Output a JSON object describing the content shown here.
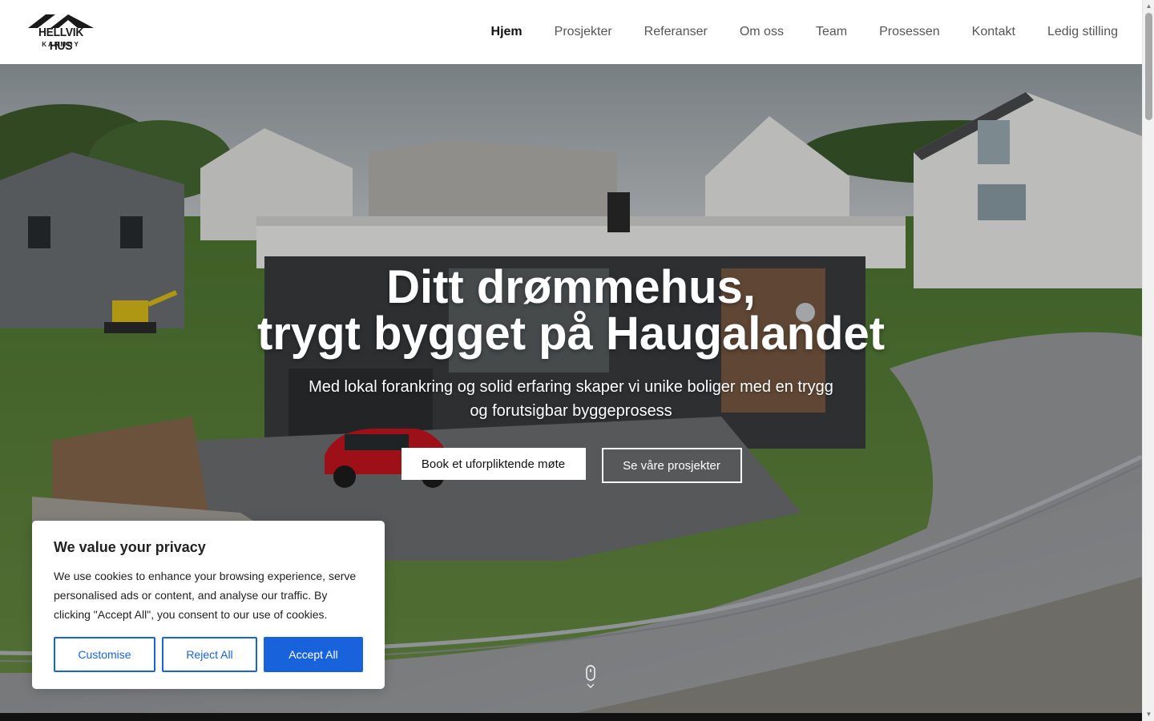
{
  "brand": {
    "name": "HELLVIK HUS",
    "sub": "KARMØY"
  },
  "nav": {
    "items": [
      {
        "label": "Hjem",
        "active": true
      },
      {
        "label": "Prosjekter",
        "active": false
      },
      {
        "label": "Referanser",
        "active": false
      },
      {
        "label": "Om oss",
        "active": false
      },
      {
        "label": "Team",
        "active": false
      },
      {
        "label": "Prosessen",
        "active": false
      },
      {
        "label": "Kontakt",
        "active": false
      },
      {
        "label": "Ledig stilling",
        "active": false
      }
    ]
  },
  "hero": {
    "title_line1": "Ditt drømmehus,",
    "title_line2": "trygt bygget på Haugalandet",
    "subtitle": "Med lokal forankring og solid erfaring skaper vi unike boliger med en trygg og forutsigbar byggeprosess",
    "primary_button": "Book et uforpliktende møte",
    "secondary_button": "Se våre prosjekter",
    "image_icon": "house-photo"
  },
  "cookie": {
    "title": "We value your privacy",
    "text": "We use cookies to enhance your browsing experience, serve personalised ads or content, and analyse our traffic. By clicking \"Accept All\", you consent to our use of cookies.",
    "customise": "Customise",
    "reject": "Reject All",
    "accept": "Accept All"
  },
  "colors": {
    "accent": "#1863dc",
    "nav_text": "#555555",
    "nav_active": "#111111"
  }
}
